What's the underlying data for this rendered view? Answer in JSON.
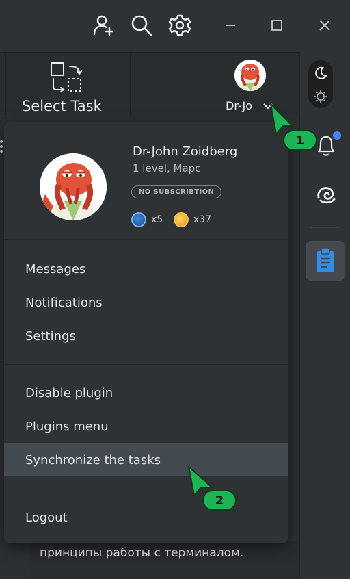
{
  "titlebar": {
    "icons": [
      "add-user-icon",
      "search-icon",
      "gear-icon",
      "minimize-icon",
      "maximize-icon",
      "close-icon"
    ]
  },
  "toolbar": {
    "select_task_label": "Select Task",
    "profile_short_name": "Dr-Jo"
  },
  "profile": {
    "name": "Dr-John Zoidberg",
    "level": "1 level, Марс",
    "subscription_badge": "NO SUBSCRIBTION",
    "gems_count": "x5",
    "coins_count": "x37"
  },
  "menu": {
    "group1": [
      {
        "label": "Messages"
      },
      {
        "label": "Notifications"
      },
      {
        "label": "Settings"
      }
    ],
    "group2": [
      {
        "label": "Disable plugin"
      },
      {
        "label": "Plugins menu"
      },
      {
        "label": "Synchronize the tasks"
      }
    ],
    "logout_label": "Logout"
  },
  "background_text": "принципы работы с терминалом.",
  "callouts": [
    {
      "number": "1"
    },
    {
      "number": "2"
    }
  ],
  "colors": {
    "accent_green": "#1eb456",
    "notification_dot": "#4a82ff",
    "tasks_icon_blue": "#2f8ee8",
    "menu_active_bg": "#434a50"
  }
}
